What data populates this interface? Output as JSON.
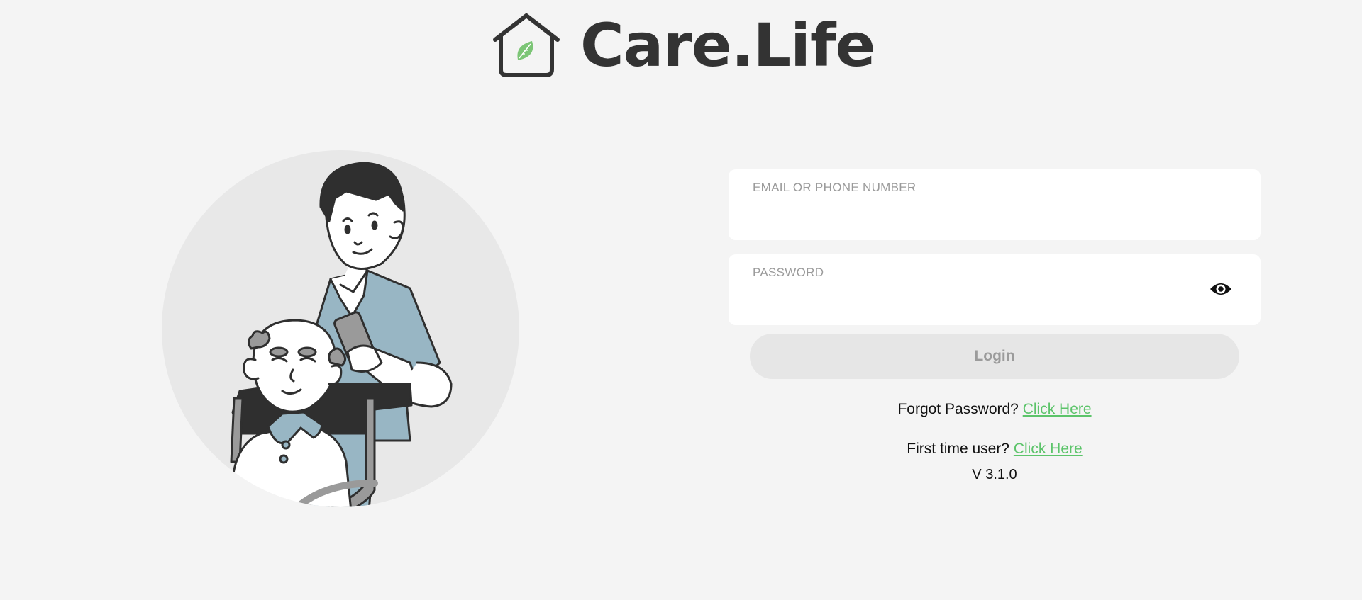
{
  "brand": {
    "name": "Care.Life",
    "icon": "house-leaf-icon",
    "leaf_color": "#7cc576",
    "text_color": "#333333"
  },
  "illustration": {
    "description_icon": "caregiver-illustration"
  },
  "login_form": {
    "email_label": "EMAIL OR PHONE NUMBER",
    "email_value": "",
    "password_label": "PASSWORD",
    "password_value": "",
    "toggle_icon": "eye-icon",
    "login_label": "Login"
  },
  "links": {
    "forgot_text": "Forgot Password?",
    "forgot_link": "Click Here",
    "first_time_text": "First time user?",
    "first_time_link": "Click Here",
    "link_color": "#5cc46a"
  },
  "version": "V 3.1.0"
}
